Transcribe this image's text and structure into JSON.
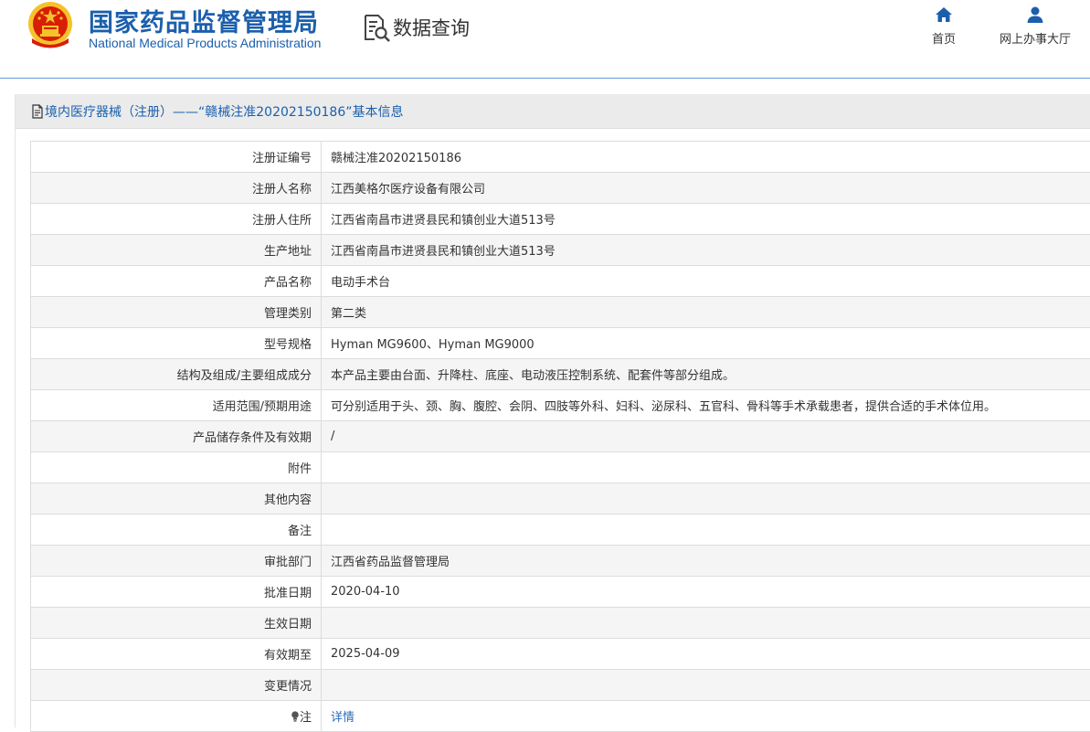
{
  "header": {
    "title": "国家药品监督管理局",
    "subtitle": "National Medical Products Administration",
    "query_label": "数据查询",
    "nav": {
      "home": "首页",
      "hall": "网上办事大厅"
    }
  },
  "panel": {
    "title": "境内医疗器械（注册）——“赣械注准20202150186”基本信息"
  },
  "rows": [
    {
      "label": "注册证编号",
      "value": "赣械注准20202150186"
    },
    {
      "label": "注册人名称",
      "value": "江西美格尔医疗设备有限公司"
    },
    {
      "label": "注册人住所",
      "value": "江西省南昌市进贤县民和镇创业大道513号"
    },
    {
      "label": "生产地址",
      "value": "江西省南昌市进贤县民和镇创业大道513号"
    },
    {
      "label": "产品名称",
      "value": "电动手术台"
    },
    {
      "label": "管理类别",
      "value": "第二类"
    },
    {
      "label": "型号规格",
      "value": "Hyman MG9600、Hyman MG9000"
    },
    {
      "label": "结构及组成/主要组成成分",
      "value": "本产品主要由台面、升降柱、底座、电动液压控制系统、配套件等部分组成。"
    },
    {
      "label": "适用范围/预期用途",
      "value": "可分别适用于头、颈、胸、腹腔、会阴、四肢等外科、妇科、泌尿科、五官科、骨科等手术承载患者，提供合适的手术体位用。"
    },
    {
      "label": "产品储存条件及有效期",
      "value": "/"
    },
    {
      "label": "附件",
      "value": ""
    },
    {
      "label": "其他内容",
      "value": ""
    },
    {
      "label": "备注",
      "value": ""
    },
    {
      "label": "审批部门",
      "value": "江西省药品监督管理局"
    },
    {
      "label": "批准日期",
      "value": "2020-04-10"
    },
    {
      "label": "生效日期",
      "value": ""
    },
    {
      "label": "有效期至",
      "value": "2025-04-09"
    },
    {
      "label": "变更情况",
      "value": ""
    }
  ],
  "note_row": {
    "label": "注",
    "link": "详情",
    "icon": "bulb-icon"
  },
  "icons": {
    "emblem": "national-emblem-icon",
    "query": "document-search-icon",
    "home": "home-icon",
    "hall": "user-icon",
    "doc": "document-icon"
  },
  "colors": {
    "brand_blue": "#1b5fac",
    "link_blue": "#2b6cb8",
    "header_rule": "#5e9bd6",
    "panel_head_bg": "#ebebeb",
    "row_alt_bg": "#f5f5f5",
    "emblem_red": "#d81e06",
    "emblem_gold": "#f6c22b"
  }
}
